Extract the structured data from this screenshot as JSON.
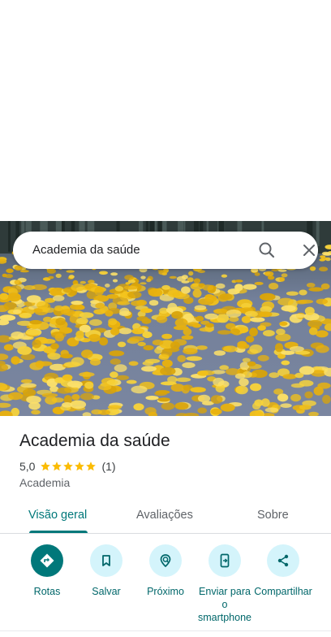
{
  "search": {
    "query": "Academia da saúde"
  },
  "place": {
    "title": "Academia da saúde",
    "rating": "5,0",
    "stars": 5,
    "review_count": "(1)",
    "category": "Academia"
  },
  "tabs": [
    {
      "label": "Visão geral",
      "active": true
    },
    {
      "label": "Avaliações",
      "active": false
    },
    {
      "label": "Sobre",
      "active": false
    }
  ],
  "actions": [
    {
      "label": "Rotas",
      "icon": "directions-icon"
    },
    {
      "label": "Salvar",
      "icon": "bookmark-icon"
    },
    {
      "label": "Próximo",
      "icon": "nearby-icon"
    },
    {
      "label": "Enviar para o smartphone",
      "icon": "send-to-phone-icon"
    },
    {
      "label": "Compartilhar",
      "icon": "share-icon"
    }
  ],
  "colors": {
    "accent": "#00787a",
    "action_bg": "#d4f4fb",
    "star": "#fbbc04"
  }
}
